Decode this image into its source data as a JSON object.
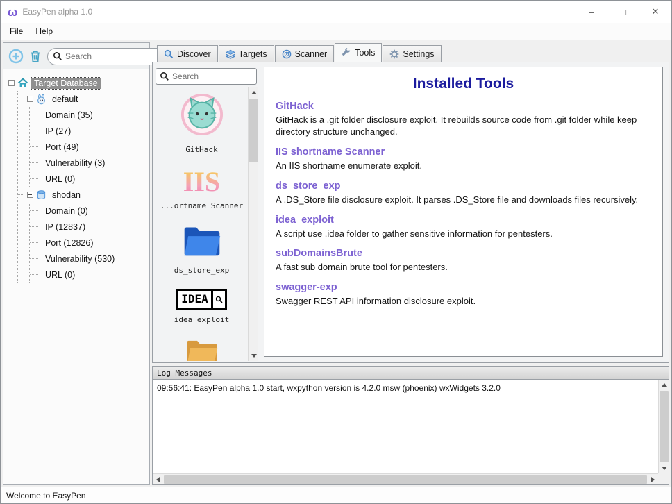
{
  "window": {
    "title": "EasyPen alpha 1.0",
    "status": "Welcome to EasyPen",
    "controls": {
      "minimize_icon": "–",
      "maximize_icon": "□",
      "close_icon": "✕"
    }
  },
  "icons": {
    "clear_icon": "✕",
    "app_glyph": "ω"
  },
  "menu": {
    "items": [
      {
        "label": "File"
      },
      {
        "label": "Help"
      }
    ]
  },
  "sidebar": {
    "search": {
      "placeholder": "Search"
    },
    "tree": {
      "root": "Target Database",
      "groups": [
        {
          "name": "default",
          "items": [
            {
              "label": "Domain (35)"
            },
            {
              "label": "IP (27)"
            },
            {
              "label": "Port (49)"
            },
            {
              "label": "Vulnerability (3)"
            },
            {
              "label": "URL (0)"
            }
          ]
        },
        {
          "name": "shodan",
          "items": [
            {
              "label": "Domain (0)"
            },
            {
              "label": "IP (12837)"
            },
            {
              "label": "Port (12826)"
            },
            {
              "label": "Vulnerability (530)"
            },
            {
              "label": "URL (0)"
            }
          ]
        }
      ]
    }
  },
  "tabs": [
    {
      "label": "Discover"
    },
    {
      "label": "Targets"
    },
    {
      "label": "Scanner"
    },
    {
      "label": "Tools",
      "active": true
    },
    {
      "label": "Settings"
    }
  ],
  "tools": {
    "search": {
      "placeholder": "Search"
    },
    "list": [
      {
        "label": "GitHack",
        "icon": "cat-icon"
      },
      {
        "label": "...ortname_Scanner",
        "icon": "iis-icon",
        "icon_text": "IIS"
      },
      {
        "label": "ds_store_exp",
        "icon": "folder-icon"
      },
      {
        "label": "idea_exploit",
        "icon": "idea-icon",
        "icon_text": "IDEA"
      }
    ],
    "installed": {
      "title": "Installed Tools",
      "entries": [
        {
          "name": "GitHack",
          "description": "GitHack is a .git folder disclosure exploit. It rebuilds source code from .git folder while keep directory structure unchanged."
        },
        {
          "name": "IIS shortname Scanner",
          "description": "An IIS shortname enumerate exploit."
        },
        {
          "name": "ds_store_exp",
          "description": "A .DS_Store file disclosure exploit. It parses .DS_Store file and downloads files recursively."
        },
        {
          "name": "idea_exploit",
          "description": "A script use .idea folder to gather sensitive information for pentesters."
        },
        {
          "name": "subDomainsBrute",
          "description": "A fast sub domain brute tool for pentesters."
        },
        {
          "name": "swagger-exp",
          "description": "Swagger REST API information disclosure exploit."
        }
      ]
    }
  },
  "log": {
    "header": "Log Messages",
    "lines": [
      {
        "text": "09:56:41: EasyPen alpha 1.0 start, wxpython version is 4.2.0 msw (phoenix) wxWidgets 3.2.0"
      }
    ]
  },
  "colors": {
    "accent_purple": "#7d62d2",
    "heading_navy": "#1b1b9e",
    "folder_blue": "#3f86ea",
    "selection_gray": "#8f8f8f"
  }
}
